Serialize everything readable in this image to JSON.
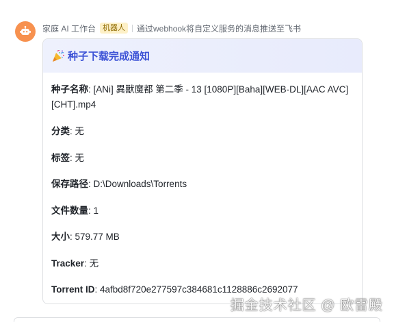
{
  "header": {
    "sender": "家庭 AI 工作台",
    "badge": "机器人",
    "description": "通过webhook将自定义服务的消息推送至飞书"
  },
  "card": {
    "title_icon": "party-popper-icon",
    "title": "种子下载完成通知",
    "fields": [
      {
        "key": "种子名称",
        "sep": ": ",
        "value": "[ANi] 異獸魔都 第二季 - 13 [1080P][Baha][WEB-DL][AAC AVC][CHT].mp4"
      },
      {
        "key": "分类",
        "sep": ": ",
        "value": "无"
      },
      {
        "key": "标签",
        "sep": ": ",
        "value": "无"
      },
      {
        "key": "保存路径",
        "sep": ": ",
        "value": "D:\\Downloads\\Torrents"
      },
      {
        "key": "文件数量",
        "sep": ": ",
        "value": "1"
      },
      {
        "key": "大小",
        "sep": ": ",
        "value": "579.77 MB"
      },
      {
        "key": "Tracker",
        "sep": ": ",
        "value": "无"
      },
      {
        "key": "Torrent ID",
        "sep": ": ",
        "value": "4afbd8f720e277597c384681c1128886c2692077"
      }
    ]
  },
  "watermark": "掘金技术社区 @ 欧雷殿",
  "colors": {
    "accent": "#3c52d6",
    "avatar": "#f7914f",
    "badge_bg": "#fdf0c7"
  }
}
